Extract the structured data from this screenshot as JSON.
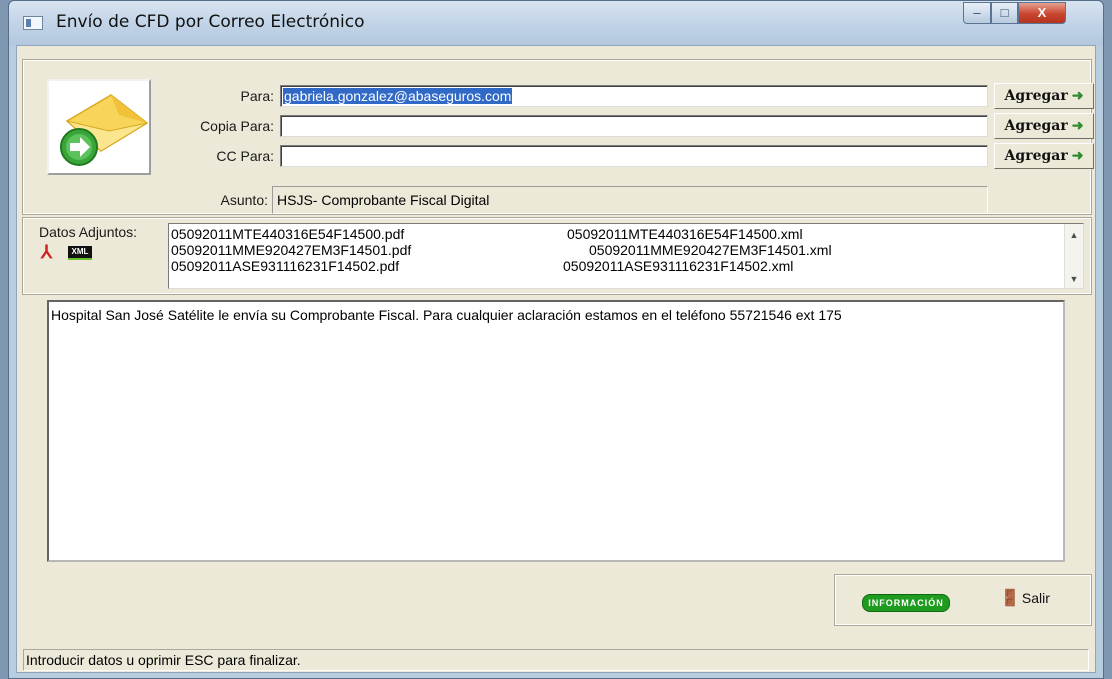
{
  "window": {
    "title": "Envío de CFD por Correo Electrónico",
    "controls": {
      "minimize": "–",
      "maximize": "□",
      "close": "X"
    }
  },
  "recipients": {
    "para_label": "Para:",
    "para_value": "gabriela.gonzalez@abaseguros.com",
    "copia_label": "Copia Para:",
    "copia_value": "",
    "cc_label": "CC Para:",
    "cc_value": "",
    "asunto_label": "Asunto:",
    "asunto_value": "HSJS- Comprobante Fiscal Digital",
    "agregar_label": "Agregar",
    "agregar_icon": "arrow-right-icon"
  },
  "attachments": {
    "label": "Datos Adjuntos:",
    "xml_icon_text": "XML",
    "rows": [
      {
        "pdf": "05092011MTE440316E54F14500.pdf",
        "xml": "05092011MTE440316E54F14500.xml"
      },
      {
        "pdf": "05092011MME920427EM3F14501.pdf",
        "xml": "05092011MME920427EM3F14501.xml"
      },
      {
        "pdf": "05092011ASE931116231F14502.pdf",
        "xml": "05092011ASE931116231F14502.xml"
      }
    ]
  },
  "message": {
    "body": "Hospital San José Satélite le envía su Comprobante Fiscal.  Para cualquier aclaración estamos en el teléfono 55721546   ext 175"
  },
  "actions": {
    "informacion_label": "INFORMACIÓN",
    "salir_label": "Salir"
  },
  "statusbar": {
    "text": "Introducir datos u oprimir ESC para finalizar."
  },
  "colors": {
    "selection": "#3169c6",
    "info_button": "#1f9b1f",
    "form_background": "#ece9d8"
  }
}
